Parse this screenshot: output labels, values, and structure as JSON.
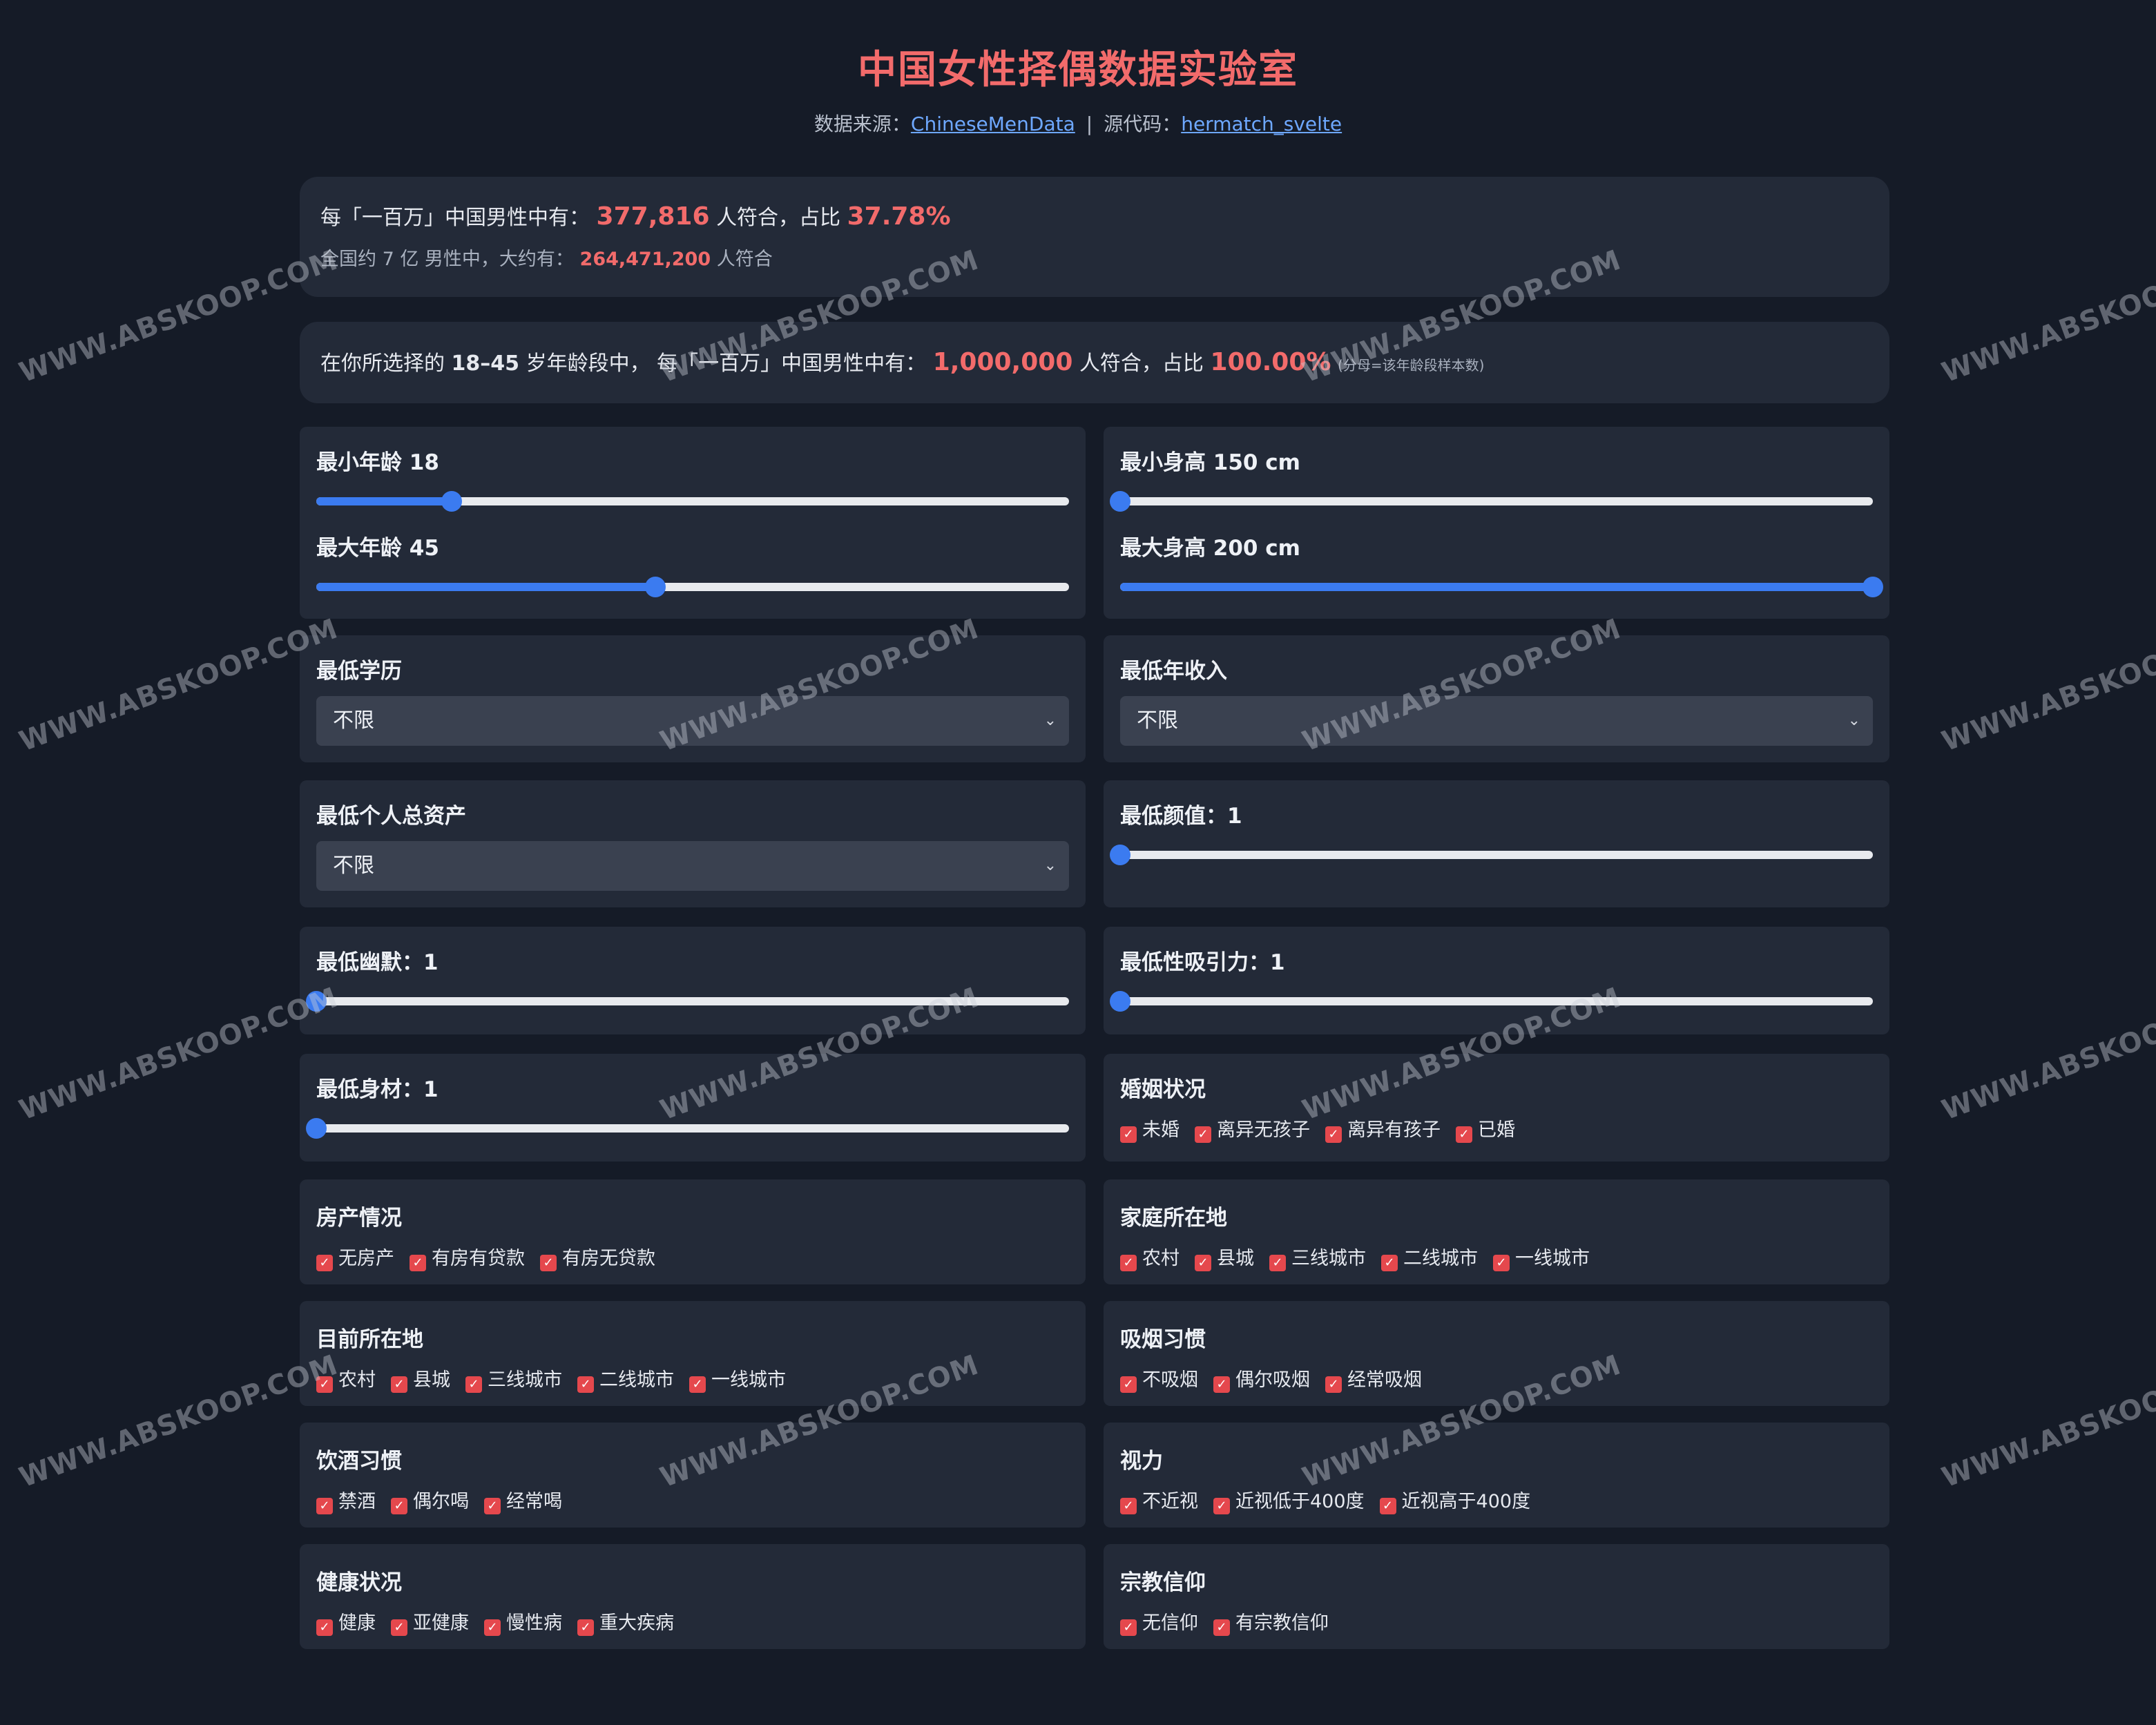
{
  "header": {
    "title": "中国女性择偶数据实验室",
    "source_prefix": "数据来源：",
    "source_link": "ChineseMenData",
    "separator": "|",
    "code_prefix": "源代码：",
    "code_link": "hermatch_svelte"
  },
  "stats": {
    "per_million_prefix": "每「一百万」中国男性中有：",
    "per_million_count": "377,816",
    "per_million_mid": "人符合，占比",
    "per_million_pct": "37.78%",
    "national_prefix": "全国约 7 亿 男性中，大约有：",
    "national_count": "264,471,200",
    "national_suffix": "人符合"
  },
  "age_stats": {
    "prefix_a": "在你所选择的",
    "age_range": "18–45",
    "prefix_b": "岁年龄段中，",
    "prefix_c": "每「一百万」中国男性中有：",
    "count": "1,000,000",
    "mid": "人符合，占比",
    "pct": "100.00%",
    "note": "(分母=该年龄段样本数)"
  },
  "filters": {
    "age": {
      "min_label": "最小年龄 18",
      "max_label": "最大年龄 45",
      "min_value": 18,
      "max_value": 45,
      "range": [
        0,
        100
      ]
    },
    "height": {
      "min_label": "最小身高 150 cm",
      "max_label": "最大身高 200 cm",
      "min_value": 150,
      "max_value": 200,
      "range": [
        150,
        200
      ]
    },
    "education": {
      "label": "最低学历",
      "selected": "不限"
    },
    "income": {
      "label": "最低年收入",
      "selected": "不限"
    },
    "assets": {
      "label": "最低个人总资产",
      "selected": "不限"
    },
    "looks": {
      "label": "最低颜值：1",
      "value": 1,
      "range": [
        1,
        10
      ]
    },
    "humor": {
      "label": "最低幽默：1",
      "value": 1,
      "range": [
        1,
        10
      ]
    },
    "sex_appeal": {
      "label": "最低性吸引力：1",
      "value": 1,
      "range": [
        1,
        10
      ]
    },
    "physique": {
      "label": "最低身材：1",
      "value": 1,
      "range": [
        1,
        10
      ]
    },
    "marital": {
      "label": "婚姻状况",
      "options": [
        "未婚",
        "离异无孩子",
        "离异有孩子",
        "已婚"
      ]
    },
    "property": {
      "label": "房产情况",
      "options": [
        "无房产",
        "有房有贷款",
        "有房无贷款"
      ]
    },
    "family_location": {
      "label": "家庭所在地",
      "options": [
        "农村",
        "县城",
        "三线城市",
        "二线城市",
        "一线城市"
      ]
    },
    "current_location": {
      "label": "目前所在地",
      "options": [
        "农村",
        "县城",
        "三线城市",
        "二线城市",
        "一线城市"
      ]
    },
    "smoking": {
      "label": "吸烟习惯",
      "options": [
        "不吸烟",
        "偶尔吸烟",
        "经常吸烟"
      ]
    },
    "drinking": {
      "label": "饮酒习惯",
      "options": [
        "禁酒",
        "偶尔喝",
        "经常喝"
      ]
    },
    "vision": {
      "label": "视力",
      "options": [
        "不近视",
        "近视低于400度",
        "近视高于400度"
      ]
    },
    "health": {
      "label": "健康状况",
      "options": [
        "健康",
        "亚健康",
        "慢性病",
        "重大疾病"
      ]
    },
    "religion": {
      "label": "宗教信仰",
      "options": [
        "无信仰",
        "有宗教信仰"
      ]
    }
  },
  "checkbox_glyph": "✓",
  "select_chevron": "⌄",
  "watermark": "WWW.ABSKOOP.COM",
  "colors": {
    "accent": "#f26b6b",
    "slider": "#3b7bf0",
    "checkbox": "#e5484d",
    "link": "#6ea8ff",
    "background": "#151b27",
    "card": "#232a38"
  }
}
